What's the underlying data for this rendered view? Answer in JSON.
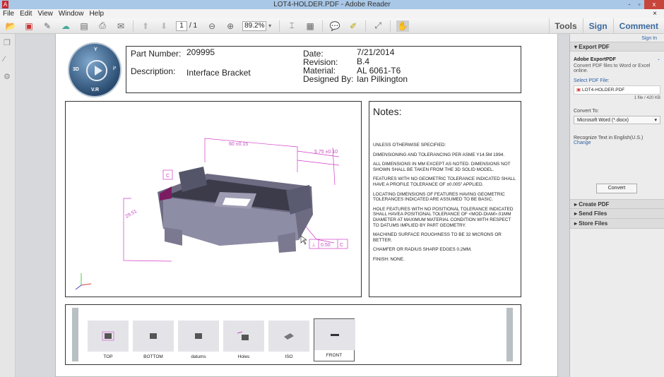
{
  "window": {
    "title": "LOT4-HOLDER.PDF - Adobe Reader",
    "minimize": "-",
    "maximize": "▫",
    "close": "x"
  },
  "menu": [
    "File",
    "Edit",
    "View",
    "Window",
    "Help"
  ],
  "toolbar": {
    "page_current": "1",
    "page_total": "/ 1",
    "zoom": "89.2%",
    "tools": "Tools",
    "sign": "Sign",
    "comment": "Comment"
  },
  "titleblock": {
    "part_number_label": "Part Number:",
    "part_number": "209995",
    "description_label": "Description:",
    "description": "Interface Bracket",
    "date_label": "Date:",
    "date": "7/21/2014",
    "revision_label": "Revision:",
    "revision": "B.4",
    "material_label": "Material:",
    "material": "AL 6061-T6",
    "designed_by_label": "Designed By:",
    "designed_by": "Ian Pilkington"
  },
  "logo": {
    "top": "Y",
    "left": "3D",
    "right": "i²",
    "bottom": "V.R"
  },
  "model": {
    "dim1": "60 ±0.15",
    "dim2": "5.75 ±0.10",
    "dim3": "29.51",
    "datum": "C",
    "fcf_tol": "0.50",
    "fcf_datum": "C"
  },
  "notes": {
    "title": "Notes:",
    "items": [
      "UNLESS OTHERWISE SPECIFIED:",
      "DIMENSIONING AND TOLERANCING PER ASME Y14.5M 1994.",
      "ALL DIMENSIONS IN MM EXCEPT AS NOTED. DIMENSIONS NOT SHOWN SHALL BE TAKEN FROM THE 3D SOLID MODEL.",
      "FEATURES WITH NO GEOMETRIC TOLERANCE INDICATED SHALL HAVE A PROFILE TOLERANCE OF ±0.005\" APPLIED.",
      "LOCATING DIMENSIONS OF FEATURES HAVING GEOMETRIC TOLERANCES INDICATED ARE ASSUMED TO BE BASIC.",
      "HOLE FEATURES WITH NO POSITIONAL TOLERANCE INDICATED SHALL HAVEA POSITIONAL TOLERANCE OF <MOD-DIAM>.01mm DIAMETER AT MAXIMUM MATERIAL CONDITION WITH RESPECT TO DATUMS IMPLIED BY PART GEOMETRY.",
      "MACHINED SURFACE ROUGHNESS TO BE 32 MICRONS OR BETTER.",
      "CHAMFER OR RADIUS SHARP EDGES 0.2mm.",
      "FINISH:  NONE."
    ]
  },
  "views": [
    "TOP",
    "BOTTOM",
    "datums",
    "Holes",
    "ISO",
    "FRONT"
  ],
  "selected_view": "FRONT",
  "panel": {
    "sign_in": "Sign In",
    "export_title": "Export PDF",
    "export_heading": "Adobe ExportPDF",
    "export_desc": "Convert PDF files to Word or Excel online.",
    "select_label": "Select PDF File:",
    "file_name": "LOT4-HOLDER.PDF",
    "file_info": "1 file / 420 KB",
    "convert_to_label": "Convert To:",
    "convert_to_value": "Microsoft Word (*.docx)",
    "recognize": "Recognize Text in English(U.S.)",
    "change": "Change",
    "convert_button": "Convert",
    "create_pdf": "Create PDF",
    "send_files": "Send Files",
    "store_files": "Store Files"
  }
}
